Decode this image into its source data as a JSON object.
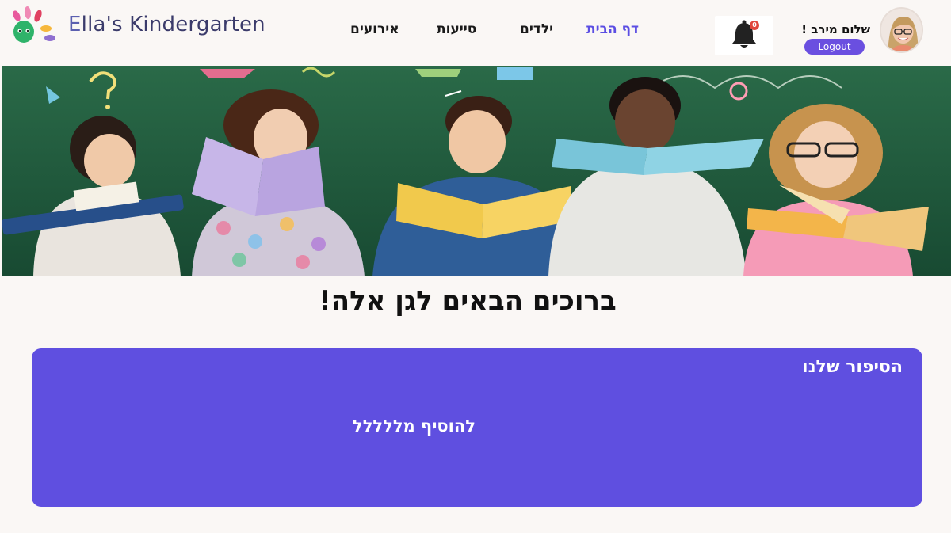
{
  "brand": {
    "name_first": "E",
    "name_rest": "lla's Kindergarten"
  },
  "nav": {
    "events": "אירועים",
    "trips": "סייעות",
    "kids": "ילדים",
    "home": "דף הבית"
  },
  "notifications": {
    "count": "0",
    "icon": "bell-icon"
  },
  "user": {
    "greeting": "שלום מירב !",
    "logout_label": "Logout"
  },
  "welcome": {
    "heading": "ברוכים הבאים לגן אלה!"
  },
  "story": {
    "title": "הסיפור שלנו",
    "body": "להוסיף מללללל"
  },
  "colors": {
    "accent": "#5b4ee3",
    "story_bg": "#5f4fe0",
    "page_bg": "#faf7f5",
    "hero_bg": "#1f5b3e"
  }
}
